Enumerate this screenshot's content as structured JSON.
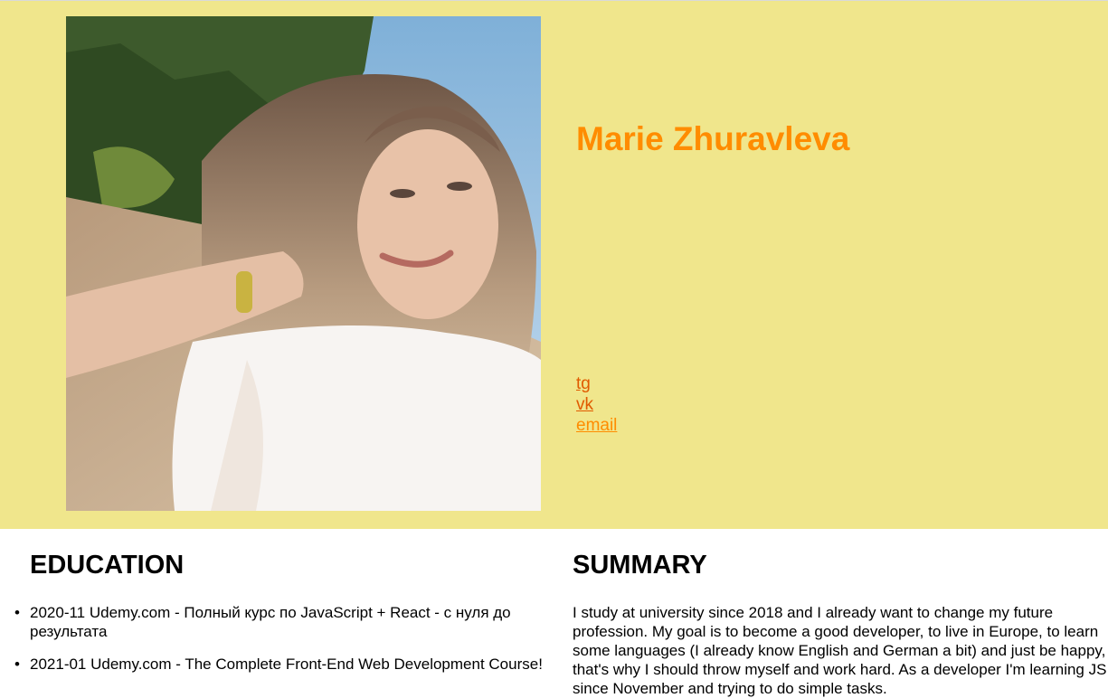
{
  "profile": {
    "name": "Marie Zhuravleva",
    "photo_icon": "profile-photo"
  },
  "links": {
    "tg": "tg",
    "vk": "vk",
    "email": "email"
  },
  "education": {
    "title": "EDUCATION",
    "items": [
      "2020-11 Udemy.com - Полный курс по JavaScript + React - с нуля до результата",
      "2021-01 Udemy.com - The Complete Front-End Web Development Course!"
    ]
  },
  "summary": {
    "title": "SUMMARY",
    "text": "I study at university since 2018 and I already want to change my future profession. My goal is to become a good developer, to live in Europe, to learn some languages (I already know English and German a bit) and just be happy, that's why I should throw myself and work hard. As a developer I'm learning JS since November and trying to do simple tasks."
  },
  "colors": {
    "header_bg": "#f0e68c",
    "accent": "#ff8c00",
    "link": "#e05a00"
  }
}
